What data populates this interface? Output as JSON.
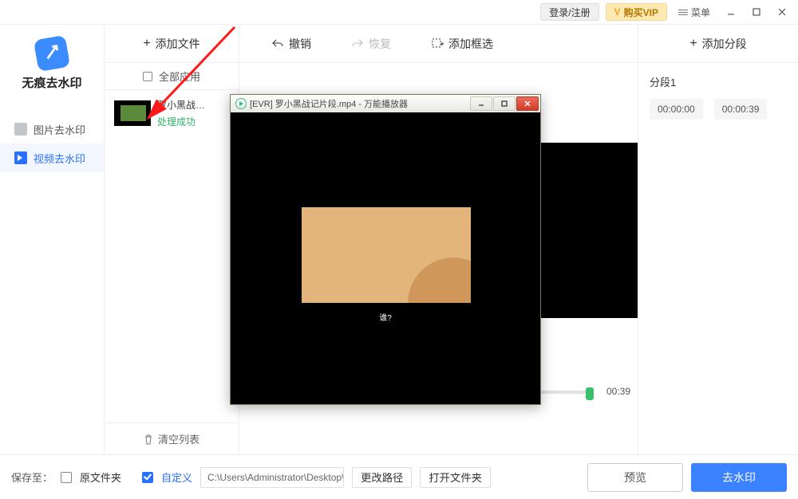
{
  "titlebar": {
    "login": "登录/注册",
    "vip_prefix": "V",
    "vip": "购买VIP",
    "menu": "菜单"
  },
  "sidebar": {
    "brand": "无痕去水印",
    "items": [
      {
        "label": "图片去水印"
      },
      {
        "label": "视频去水印"
      }
    ]
  },
  "filecol": {
    "add_file": "添加文件",
    "all_app": "全部应用",
    "file": {
      "name": "罗小黑战…",
      "status": "处理成功"
    },
    "clear": "清空列表"
  },
  "toolbar": {
    "undo": "撤销",
    "redo": "恢复",
    "addbox": "添加框选"
  },
  "segcol": {
    "add_seg": "添加分段",
    "seg_title": "分段1",
    "start": "00:00:00",
    "end": "00:00:39",
    "track_end": "00:39"
  },
  "bottom": {
    "save_to": "保存至：",
    "orig_folder": "原文件夹",
    "custom": "自定义",
    "path": "C:\\Users\\Administrator\\Desktop\\无痕…",
    "chg_path": "更改路径",
    "open_folder": "打开文件夹",
    "preview": "预览",
    "go": "去水印"
  },
  "player": {
    "title": "[EVR] 罗小黑战记片段.mp4 - 万能播放器",
    "caption": "谁?"
  }
}
